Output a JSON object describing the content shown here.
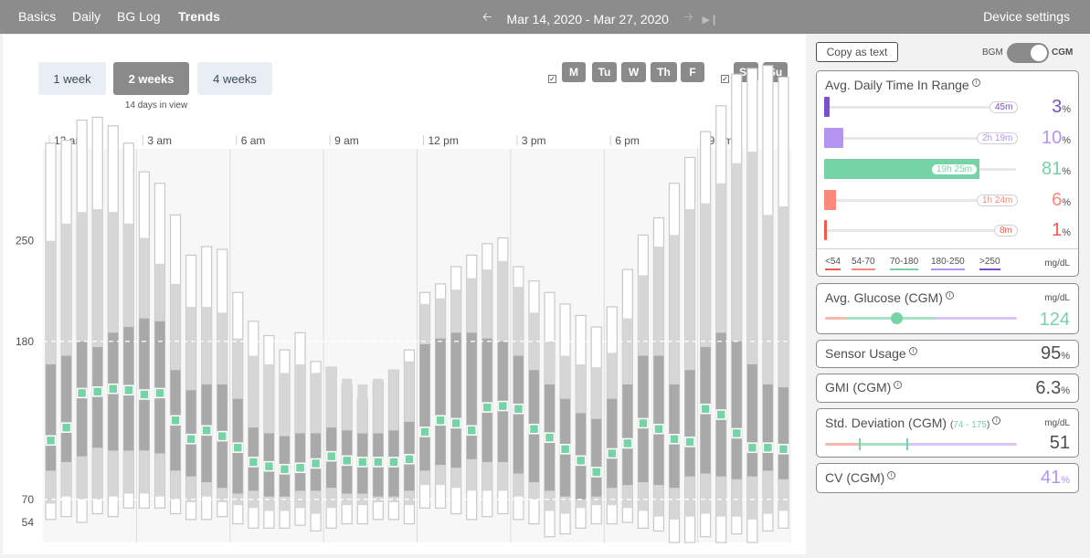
{
  "nav": {
    "tabs": [
      "Basics",
      "Daily",
      "BG Log",
      "Trends"
    ],
    "active_tab": "Trends",
    "date_range": "Mar 14, 2020 - Mar 27, 2020",
    "prev_icon": "arrow-left-icon",
    "next_icon": "arrow-right-icon",
    "most_recent_icon": "skip-to-end-icon",
    "device_settings": "Device settings"
  },
  "range_buttons": {
    "one_week": "1 week",
    "two_weeks": "2 weeks",
    "four_weeks": "4 weeks",
    "selected": "2 weeks",
    "days_in_view": "14 days in view"
  },
  "day_filters": {
    "weekdays": [
      "M",
      "Tu",
      "W",
      "Th",
      "F"
    ],
    "weekend": [
      "Sa",
      "Su"
    ],
    "weekdays_checked": true,
    "weekend_checked": true
  },
  "chart_data": {
    "type": "box-trends",
    "x_tick_labels": [
      "12 am",
      "3 am",
      "6 am",
      "9 am",
      "12 pm",
      "3 pm",
      "6 pm",
      "9 pm"
    ],
    "y_tick_labels": [
      "250",
      "180",
      "70",
      "54"
    ],
    "y_ticks": [
      250,
      180,
      70,
      54
    ],
    "ylim": [
      40,
      400
    ],
    "target_lines": [
      180,
      70
    ],
    "bin_minutes": 30,
    "series": {
      "min": [
        56,
        58,
        54,
        60,
        58,
        64,
        64,
        64,
        60,
        56,
        56,
        58,
        53,
        50,
        50,
        50,
        52,
        48,
        50,
        53,
        53,
        56,
        56,
        53,
        64,
        64,
        60,
        56,
        58,
        60,
        56,
        53,
        44,
        46,
        50,
        53,
        53,
        54,
        50,
        48,
        40,
        40,
        44,
        40,
        46,
        40,
        48,
        50
      ],
      "p10": [
        67,
        72,
        70,
        70,
        72,
        74,
        74,
        72,
        70,
        68,
        72,
        68,
        66,
        64,
        62,
        62,
        64,
        60,
        64,
        66,
        66,
        68,
        68,
        66,
        80,
        80,
        78,
        76,
        76,
        76,
        72,
        70,
        62,
        60,
        64,
        66,
        66,
        64,
        62,
        58,
        56,
        58,
        60,
        58,
        58,
        56,
        60,
        62
      ],
      "p25": [
        90,
        96,
        100,
        106,
        104,
        104,
        104,
        102,
        90,
        86,
        82,
        78,
        74,
        76,
        72,
        72,
        76,
        76,
        78,
        74,
        74,
        72,
        72,
        76,
        90,
        94,
        92,
        98,
        96,
        96,
        88,
        82,
        76,
        72,
        70,
        72,
        78,
        80,
        82,
        80,
        78,
        86,
        88,
        86,
        84,
        86,
        90,
        84
      ],
      "median": [
        111,
        120,
        144,
        145,
        147,
        146,
        143,
        144,
        125,
        112,
        118,
        114,
        106,
        96,
        93,
        91,
        92,
        95,
        100,
        97,
        96,
        96,
        96,
        98,
        117,
        125,
        123,
        118,
        134,
        135,
        133,
        119,
        113,
        105,
        97,
        89,
        102,
        109,
        123,
        119,
        112,
        110,
        133,
        129,
        116,
        106,
        106,
        105
      ],
      "p75": [
        164,
        170,
        180,
        176,
        186,
        190,
        196,
        194,
        160,
        146,
        150,
        150,
        140,
        120,
        116,
        114,
        116,
        116,
        120,
        118,
        116,
        116,
        118,
        124,
        178,
        182,
        186,
        186,
        182,
        180,
        170,
        160,
        150,
        140,
        130,
        126,
        140,
        150,
        170,
        170,
        150,
        160,
        176,
        186,
        180,
        164,
        150,
        148
      ],
      "p90": [
        250,
        262,
        270,
        272,
        270,
        262,
        252,
        234,
        220,
        204,
        204,
        200,
        182,
        170,
        164,
        158,
        164,
        158,
        162,
        154,
        150,
        154,
        160,
        166,
        206,
        210,
        216,
        224,
        230,
        236,
        218,
        200,
        180,
        170,
        164,
        162,
        172,
        196,
        226,
        246,
        254,
        272,
        276,
        290,
        304,
        312,
        268,
        274
      ],
      "max": [
        318,
        320,
        334,
        336,
        330,
        318,
        298,
        290,
        268,
        240,
        246,
        244,
        214,
        194,
        184,
        174,
        186,
        166,
        162,
        150,
        140,
        152,
        160,
        174,
        214,
        220,
        232,
        240,
        248,
        252,
        232,
        222,
        214,
        206,
        198,
        190,
        204,
        230,
        254,
        266,
        290,
        308,
        326,
        344,
        366,
        370,
        372,
        364
      ]
    }
  },
  "sidebar": {
    "copy_button": "Copy as text",
    "bgm_label": "BGM",
    "cgm_label": "CGM",
    "toggle_on": "CGM",
    "tir": {
      "title": "Avg. Daily Time In Range",
      "rows": [
        {
          "duration": "45m",
          "percent": "3",
          "fraction": 0.03,
          "color": "#7c4fcc",
          "pill_border": "#cfcfcf"
        },
        {
          "duration": "2h 19m",
          "percent": "10",
          "fraction": 0.1,
          "color": "#b394f0",
          "pill_border": "#cfcfcf"
        },
        {
          "duration": "19h 25m",
          "percent": "81",
          "fraction": 0.81,
          "color": "#76d3a6",
          "pill_border": "#76d3a6"
        },
        {
          "duration": "1h 24m",
          "percent": "6",
          "fraction": 0.06,
          "color": "#fb8878",
          "pill_border": "#cfcfcf"
        },
        {
          "duration": "8m",
          "percent": "1",
          "fraction": 0.01,
          "color": "#f25a4a",
          "pill_border": "#cfcfcf"
        }
      ],
      "percent_suffix": "%",
      "legend": [
        {
          "label": "<54",
          "color": "#f25a4a"
        },
        {
          "label": "54-70",
          "color": "#fb8878"
        },
        {
          "label": "70-180",
          "color": "#76d3a6"
        },
        {
          "label": "180-250",
          "color": "#b394f0"
        },
        {
          "label": ">250",
          "color": "#7c4fcc"
        }
      ],
      "unit": "mg/dL"
    },
    "avg_glucose": {
      "title": "Avg. Glucose (CGM)",
      "unit": "mg/dL",
      "value": "124",
      "value_color": "#76d3a6",
      "marker_fraction": 0.37
    },
    "sensor_usage": {
      "title": "Sensor Usage",
      "value": "95",
      "suffix": "%"
    },
    "gmi": {
      "title": "GMI (CGM)",
      "value": "6.3",
      "suffix": "%"
    },
    "std_dev": {
      "title": "Std. Deviation (CGM)",
      "range_open": "(",
      "range_text": "74 - 175",
      "range_close": ")",
      "unit": "mg/dL",
      "value": "51"
    },
    "cv": {
      "title": "CV (CGM)",
      "value": "41",
      "suffix": "%",
      "value_color": "#b394f0"
    }
  }
}
